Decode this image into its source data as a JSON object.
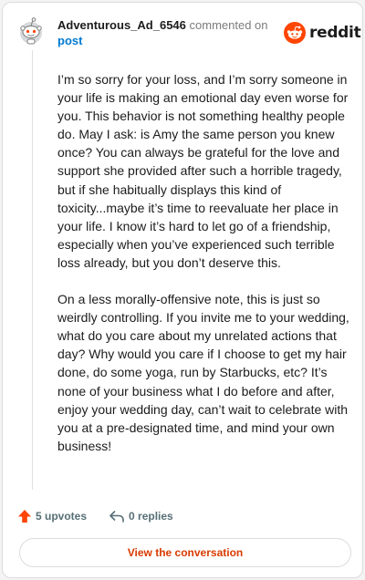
{
  "header": {
    "username": "Adventurous_Ad_6546",
    "commented_on": "commented on",
    "post_link": "post"
  },
  "brand": {
    "logo_text": "reddit",
    "logo_icon": "reddit-alien-icon",
    "accent_color": "#ff4500"
  },
  "comment": {
    "paragraphs": [
      "I’m so sorry for your loss, and I’m sorry someone in your life is making an emotional day even worse for you. This behavior is not something healthy people do. May I ask: is Amy the same person you knew once? You can always be grateful for the love and support she provided after such a horrible tragedy, but if she habitually displays this kind of toxicity...maybe it’s time to reevaluate her place in your life. I know it’s hard to let go of a friendship, especially when you’ve experienced such terrible loss already, but you don’t deserve this.",
      "On a less morally-offensive note, this is just so weirdly controlling. If you invite me to your wedding, what do you care about my unrelated actions that day? Why would you care if I choose to get my hair done, do some yoga, run by Starbucks, etc? It’s none of your business what I do before and after, enjoy your wedding day, can’t wait to celebrate with you at a pre-designated time, and mind your own business!"
    ]
  },
  "actions": {
    "upvotes": "5 upvotes",
    "replies": "0 replies",
    "view_button": "View the conversation"
  }
}
